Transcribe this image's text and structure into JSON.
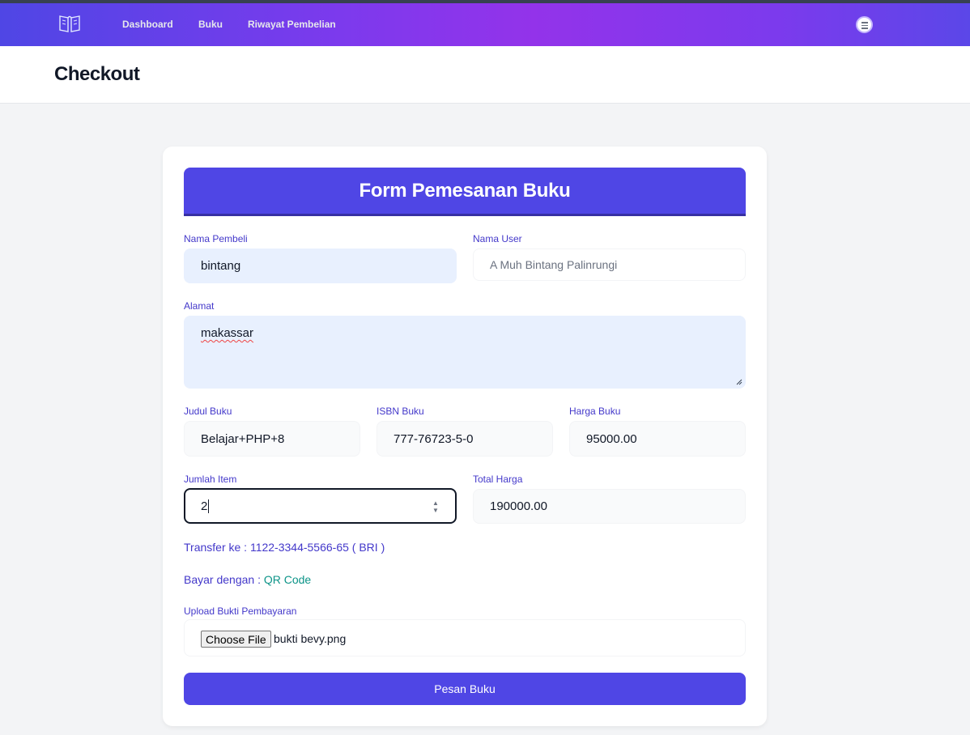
{
  "nav": {
    "logo_icon": "open-book-icon",
    "links": [
      "Dashboard",
      "Buku",
      "Riwayat Pembelian"
    ],
    "user_icon": "user-menu-icon"
  },
  "header": {
    "title": "Checkout"
  },
  "form": {
    "title": "Form Pemesanan Buku",
    "nama_pembeli": {
      "label": "Nama Pembeli",
      "value": "bintang"
    },
    "nama_user": {
      "label": "Nama User",
      "placeholder": "A Muh Bintang Palinrungi"
    },
    "alamat": {
      "label": "Alamat",
      "value": "makassar"
    },
    "judul_buku": {
      "label": "Judul Buku",
      "value": "Belajar+PHP+8"
    },
    "isbn_buku": {
      "label": "ISBN Buku",
      "value": "777-76723-5-0"
    },
    "harga_buku": {
      "label": "Harga Buku",
      "value": "95000.00"
    },
    "jumlah_item": {
      "label": "Jumlah Item",
      "value": "2"
    },
    "total_harga": {
      "label": "Total Harga",
      "value": "190000.00"
    },
    "transfer": "Transfer ke : 1122-3344-5566-65 ( BRI )",
    "bayar_prefix": "Bayar dengan : ",
    "bayar_method": "QR Code",
    "upload": {
      "label": "Upload Bukti Pembayaran",
      "button": "Choose File",
      "file_name": "bukti bevy.png"
    },
    "submit": "Pesan Buku"
  },
  "colors": {
    "primary": "#4f46e5",
    "accent_teal": "#0d9488",
    "label": "#4338ca"
  }
}
